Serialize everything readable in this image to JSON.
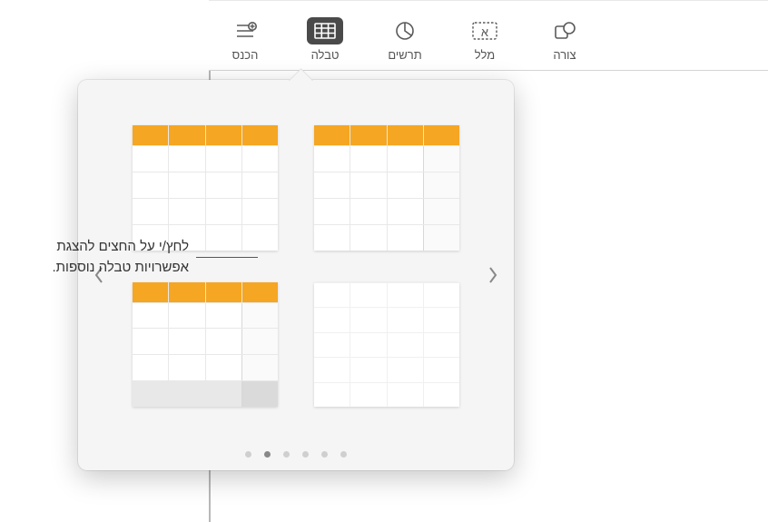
{
  "toolbar": {
    "items": [
      {
        "id": "insert",
        "label": "הכנס"
      },
      {
        "id": "table",
        "label": "טבלה"
      },
      {
        "id": "chart",
        "label": "תרשים"
      },
      {
        "id": "text",
        "label": "מלל"
      },
      {
        "id": "shape",
        "label": "צורה"
      }
    ]
  },
  "callout": {
    "text": "לחץ/י על החצים להצגת אפשרויות טבלה נוספות."
  },
  "popover": {
    "page_count": 6,
    "active_page": 1
  }
}
